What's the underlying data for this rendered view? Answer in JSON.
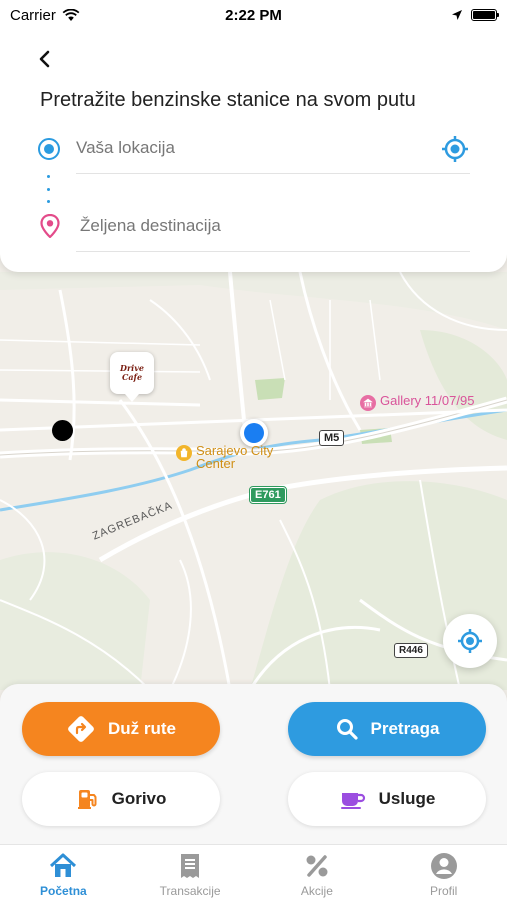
{
  "status_bar": {
    "carrier": "Carrier",
    "time": "2:22 PM"
  },
  "header": {
    "title": "Pretražite benzinske stanice na svom putu",
    "origin_placeholder": "Vaša lokacija",
    "destination_placeholder": "Željena destinacija"
  },
  "map": {
    "poi_gallery": "Gallery 11/07/95",
    "poi_city_center": "Sarajevo City Center",
    "street_zagrebacka": "ZAGREBAČKA",
    "road_m5": "M5",
    "road_e761": "E761",
    "road_r446": "R446",
    "drive_cafe_line1": "Drive",
    "drive_cafe_line2": "Cafe"
  },
  "actions": {
    "route": "Duž rute",
    "search": "Pretraga",
    "fuel": "Gorivo",
    "services": "Usluge"
  },
  "tabs": [
    {
      "label": "Početna",
      "icon": "home-icon",
      "active": true
    },
    {
      "label": "Transakcije",
      "icon": "receipt-icon",
      "active": false
    },
    {
      "label": "Akcije",
      "icon": "percent-icon",
      "active": false
    },
    {
      "label": "Profil",
      "icon": "profile-icon",
      "active": false
    }
  ],
  "colors": {
    "primary_blue": "#2e9be0",
    "accent_orange": "#f5851f",
    "tab_active": "#2e8fd6",
    "tab_inactive": "#9a9a9a",
    "pin_pink": "#e34b8a"
  }
}
